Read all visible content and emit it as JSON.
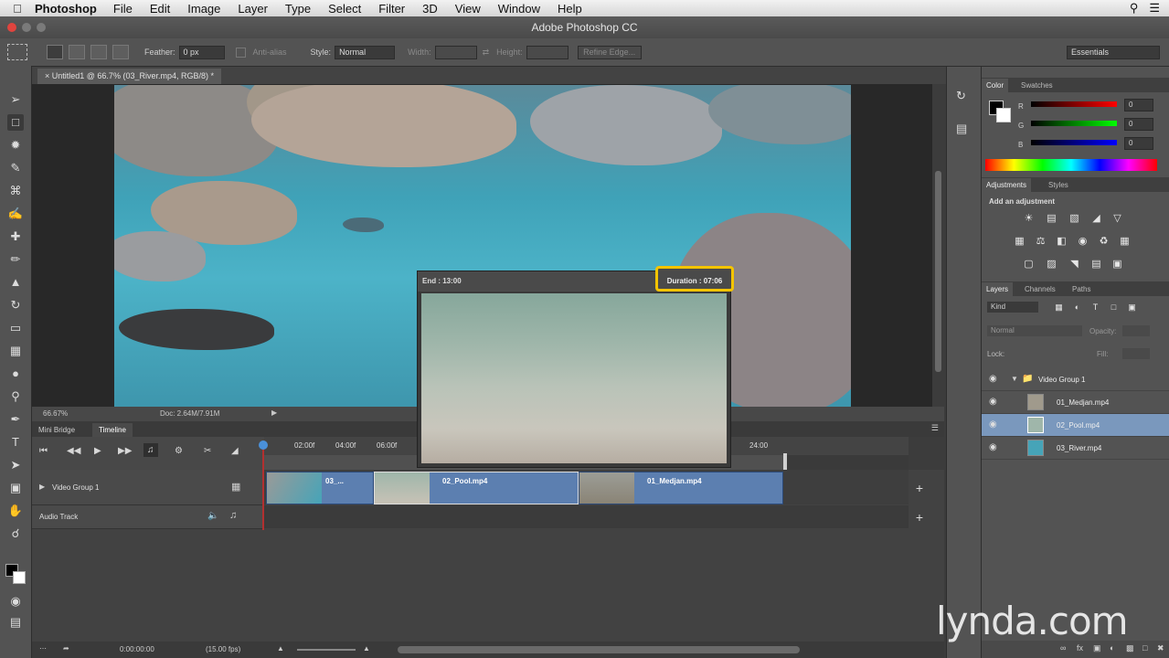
{
  "menubar": {
    "app": "Photoshop",
    "items": [
      "File",
      "Edit",
      "Image",
      "Layer",
      "Type",
      "Select",
      "Filter",
      "3D",
      "View",
      "Window",
      "Help"
    ]
  },
  "window_title": "Adobe Photoshop CC",
  "options_bar": {
    "feather_label": "Feather:",
    "feather_value": "0 px",
    "antialias_label": "Anti-alias",
    "style_label": "Style:",
    "style_value": "Normal",
    "width_label": "Width:",
    "height_label": "Height:",
    "refine_edge": "Refine Edge...",
    "workspace": "Essentials"
  },
  "document_tab": "Untitled1 @ 66.7% (03_River.mp4, RGB/8) *",
  "status_bar": {
    "zoom": "66.67%",
    "doc_info": "Doc: 2.64M/7.91M"
  },
  "preview": {
    "end_label": "End : 13:00",
    "duration_label": "Duration : 07:06"
  },
  "timeline": {
    "tabs": [
      "Mini Bridge",
      "Timeline"
    ],
    "active_tab": "Timeline",
    "ruler_ticks": [
      "02:00f",
      "04:00f",
      "06:00f",
      "24:00"
    ],
    "video_group": "Video Group 1",
    "audio_track": "Audio Track",
    "clips": [
      "03_...",
      "02_Pool.mp4",
      "01_Medjan.mp4"
    ],
    "timecode": "0:00:00:00",
    "fps": "(15.00 fps)"
  },
  "panels": {
    "color_tabs": [
      "Color",
      "Swatches"
    ],
    "channels": [
      "R",
      "G",
      "B"
    ],
    "channel_values": [
      "0",
      "0",
      "0"
    ],
    "adjust_tabs": [
      "Adjustments",
      "Styles"
    ],
    "adjust_heading": "Add an adjustment",
    "layers_tabs": [
      "Layers",
      "Channels",
      "Paths"
    ],
    "kind_label": "Kind",
    "blend_mode": "Normal",
    "opacity_label": "Opacity:",
    "lock_label": "Lock:",
    "fill_label": "Fill:",
    "layers": [
      "Video Group 1",
      "01_Medjan.mp4",
      "02_Pool.mp4",
      "03_River.mp4"
    ],
    "selected_layer": "02_Pool.mp4"
  },
  "watermark": "lynda.com",
  "colors": {
    "clip_blue": "#5c7fb0",
    "highlight": "#f4c400",
    "selected_layer": "#7a98bd"
  }
}
